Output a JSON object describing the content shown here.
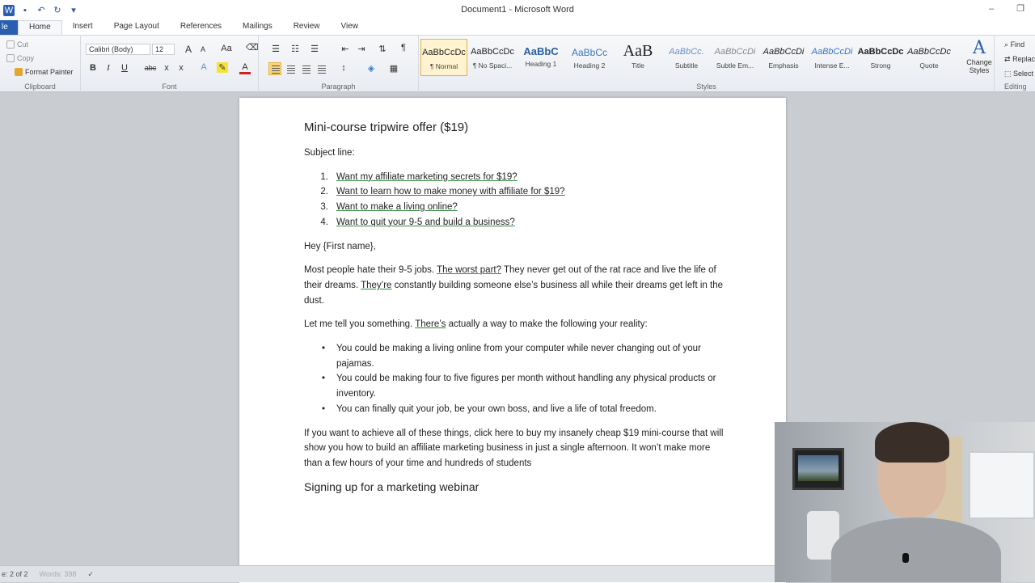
{
  "window": {
    "title": "Document1 - Microsoft Word"
  },
  "tabs": {
    "file": "le",
    "items": [
      "Home",
      "Insert",
      "Page Layout",
      "References",
      "Mailings",
      "Review",
      "View"
    ],
    "active": "Home"
  },
  "ribbon": {
    "clipboard": {
      "label": "Clipboard",
      "cut": "Cut",
      "copy": "Copy",
      "format_painter": "Format Painter"
    },
    "font": {
      "label": "Font",
      "font_name": "Calibri (Body)",
      "font_size": "12",
      "grow": "A",
      "shrink": "A",
      "case": "Aa",
      "bold": "B",
      "italic": "I",
      "underline": "U",
      "strike": "abc",
      "subscript": "x",
      "superscript": "x",
      "font_color_label": "A",
      "font_color": "#d02020"
    },
    "paragraph": {
      "label": "Paragraph",
      "pilcrow": "¶"
    },
    "styles": {
      "label": "Styles",
      "items": [
        {
          "sample": "AaBbCcDc",
          "name": "¶ Normal"
        },
        {
          "sample": "AaBbCcDc",
          "name": "¶ No Spaci..."
        },
        {
          "sample": "AaBbC",
          "name": "Heading 1"
        },
        {
          "sample": "AaBbCc",
          "name": "Heading 2"
        },
        {
          "sample": "AaB",
          "name": "Title"
        },
        {
          "sample": "AaBbCc.",
          "name": "Subtitle"
        },
        {
          "sample": "AaBbCcDi",
          "name": "Subtle Em..."
        },
        {
          "sample": "AaBbCcDi",
          "name": "Emphasis"
        },
        {
          "sample": "AaBbCcDi",
          "name": "Intense E..."
        },
        {
          "sample": "AaBbCcDc",
          "name": "Strong"
        },
        {
          "sample": "AaBbCcDc",
          "name": "Quote"
        }
      ],
      "change_styles": "Change Styles"
    },
    "editing": {
      "label": "Editing",
      "find": "Find",
      "replace": "Replace",
      "select": "Select"
    }
  },
  "document": {
    "heading": "Mini-course tripwire offer ($19)",
    "subject_label": "Subject line:",
    "subject_lines": [
      {
        "num": "1.",
        "text": "Want my affiliate marketing secrets for $19?"
      },
      {
        "num": "2.",
        "text": "Want to learn how to make money with affiliate for $19?"
      },
      {
        "num": "3.",
        "text": "Want to make a living online?"
      },
      {
        "num": "4.",
        "text": "Want to quit your 9-5 and build a business?"
      }
    ],
    "greeting": "Hey {First name},",
    "para1_a": "Most people hate their 9-5 jobs. ",
    "para1_u1": "The worst part?",
    "para1_b": " They never get out of the rat race and live the life of their dreams. ",
    "para1_u2": "They’re",
    "para1_c": " constantly building someone else’s business all while their dreams get left in the dust.",
    "para2_a": "Let me tell you something. ",
    "para2_u": "There’s",
    "para2_b": " actually a way to make the following your reality:",
    "bullets": [
      "You could be making a living online from your computer while never changing out of your pajamas.",
      "You could be making four to five figures per month without handling any physical products or inventory.",
      "You can finally quit your job, be your own boss, and live a life of total freedom."
    ],
    "para3": "If you want to achieve all of these things, click here to buy my insanely cheap $19 mini-course that will show you how to build an affiliate marketing business in just a single afternoon. It won’t make more than a few hours of your time and hundreds of students",
    "heading2": "Signing up for a marketing webinar"
  },
  "statusbar": {
    "page": "e: 2 of 2",
    "words": "Words: 398"
  }
}
